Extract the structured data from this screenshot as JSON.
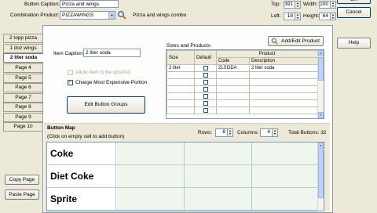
{
  "header": {
    "button_caption_label": "Button Caption:",
    "button_caption_value": "Pizza and wings",
    "combination_product_label": "Combination Product:",
    "combination_product_value": "PIZZAWINGS",
    "combination_product_desc": "Pizza and wings combo",
    "top_label": "Top:",
    "top_value": "391",
    "width_label": "Width:",
    "width_value": "200",
    "left_label": "Left:",
    "left_value": "18",
    "height_label": "Height:",
    "height_value": "64"
  },
  "right_buttons": {
    "ok": "OK",
    "cancel": "Cancel",
    "help": "Help"
  },
  "tabs": [
    {
      "label": "2 topp pizza"
    },
    {
      "label": "1 doz wings"
    },
    {
      "label": "2 liter soda"
    },
    {
      "label": "Page 4"
    },
    {
      "label": "Page 5"
    },
    {
      "label": "Page 6"
    },
    {
      "label": "Page 7"
    },
    {
      "label": "Page 8"
    },
    {
      "label": "Page 9"
    },
    {
      "label": "Page 10"
    }
  ],
  "selected_tab": "2 liter soda",
  "page": {
    "item_caption_label": "Item Caption:",
    "item_caption_value": "2 liter soda",
    "disabled_option_label": "Allow item to be upsized",
    "charge_most_expensive_label": "Charge Most Expensive Portion",
    "charge_most_expensive_checked": "✓",
    "edit_button_groups": "Edit Button Groups"
  },
  "sizes": {
    "title": "Sizes and Products",
    "add_edit_product": "Add/Edit Product",
    "col_size": "Size",
    "col_default": "Default",
    "col_product": "Product",
    "col_code": "Code",
    "col_description": "Description",
    "rows": [
      {
        "size": "2 liter",
        "default": "",
        "code": "2LSODA",
        "description": "2 liter soda"
      },
      {
        "size": "",
        "default": "",
        "code": "",
        "description": ""
      },
      {
        "size": "",
        "default": "",
        "code": "",
        "description": ""
      },
      {
        "size": "",
        "default": "",
        "code": "",
        "description": ""
      },
      {
        "size": "",
        "default": "",
        "code": "",
        "description": ""
      },
      {
        "size": "",
        "default": "",
        "code": "",
        "description": ""
      },
      {
        "size": "",
        "default": "",
        "code": "",
        "description": ""
      }
    ]
  },
  "button_map": {
    "title": "Button Map",
    "hint": "(Click on empty cell to add button)",
    "rows_label": "Rows:",
    "rows_value": "8",
    "columns_label": "Columns:",
    "columns_value": "4",
    "total_label": "Total Buttons:",
    "total_value": "32",
    "items": [
      "Coke",
      "Diet Coke",
      "Sprite"
    ]
  },
  "bottom_buttons": {
    "copy_page": "Copy Page",
    "paste_page": "Paste Page"
  },
  "colors": {
    "accent_border": "#003c74",
    "map_cell": "#eef6ef",
    "window_bg": "#ece9d8"
  },
  "icons": {
    "search": "magnifier-icon",
    "add_product": "magnifier-icon"
  }
}
